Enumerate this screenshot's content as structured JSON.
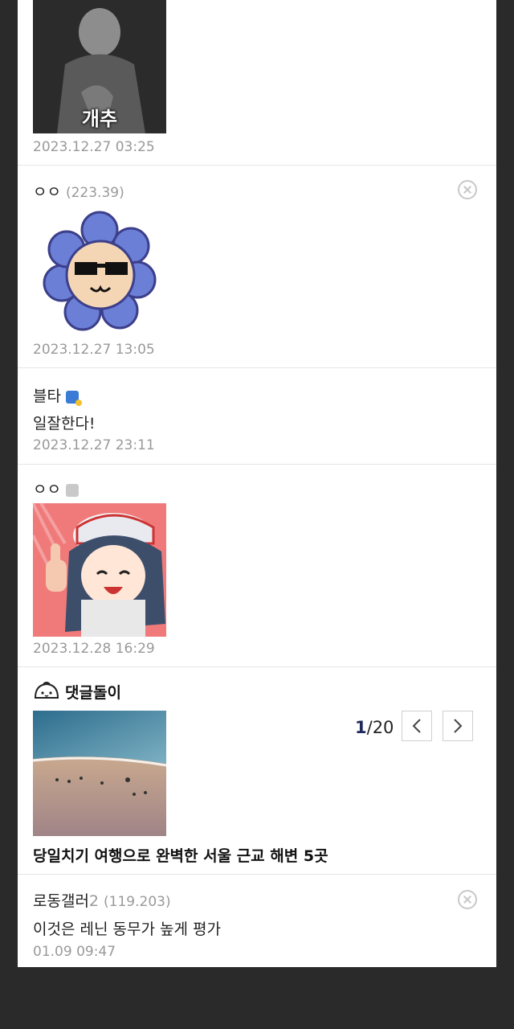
{
  "comments": [
    {
      "time": "2023.12.27 03:25",
      "image_caption": "개추"
    },
    {
      "author": "ㅇㅇ",
      "ip": "(223.39)",
      "time": "2023.12.27 13:05"
    },
    {
      "author": "블타",
      "text": "일잘한다!",
      "time": "2023.12.27 23:11"
    },
    {
      "author": "ㅇㅇ",
      "time": "2023.12.28 16:29"
    }
  ],
  "bot": {
    "name": "댓글돌이",
    "page_current": "1",
    "page_total": "/20",
    "headline": "당일치기 여행으로 완벽한 서울 근교 해변 5곳"
  },
  "last_comment": {
    "author": "로동갤러",
    "author_suffix": "2",
    "ip": "(119.203)",
    "text": "이것은 레닌 동무가 높게 평가",
    "time": "01.09 09:47"
  },
  "colors": {
    "page_bg": "#2a2a2a",
    "accent_navy": "#1f2a5a",
    "muted": "#999999"
  }
}
